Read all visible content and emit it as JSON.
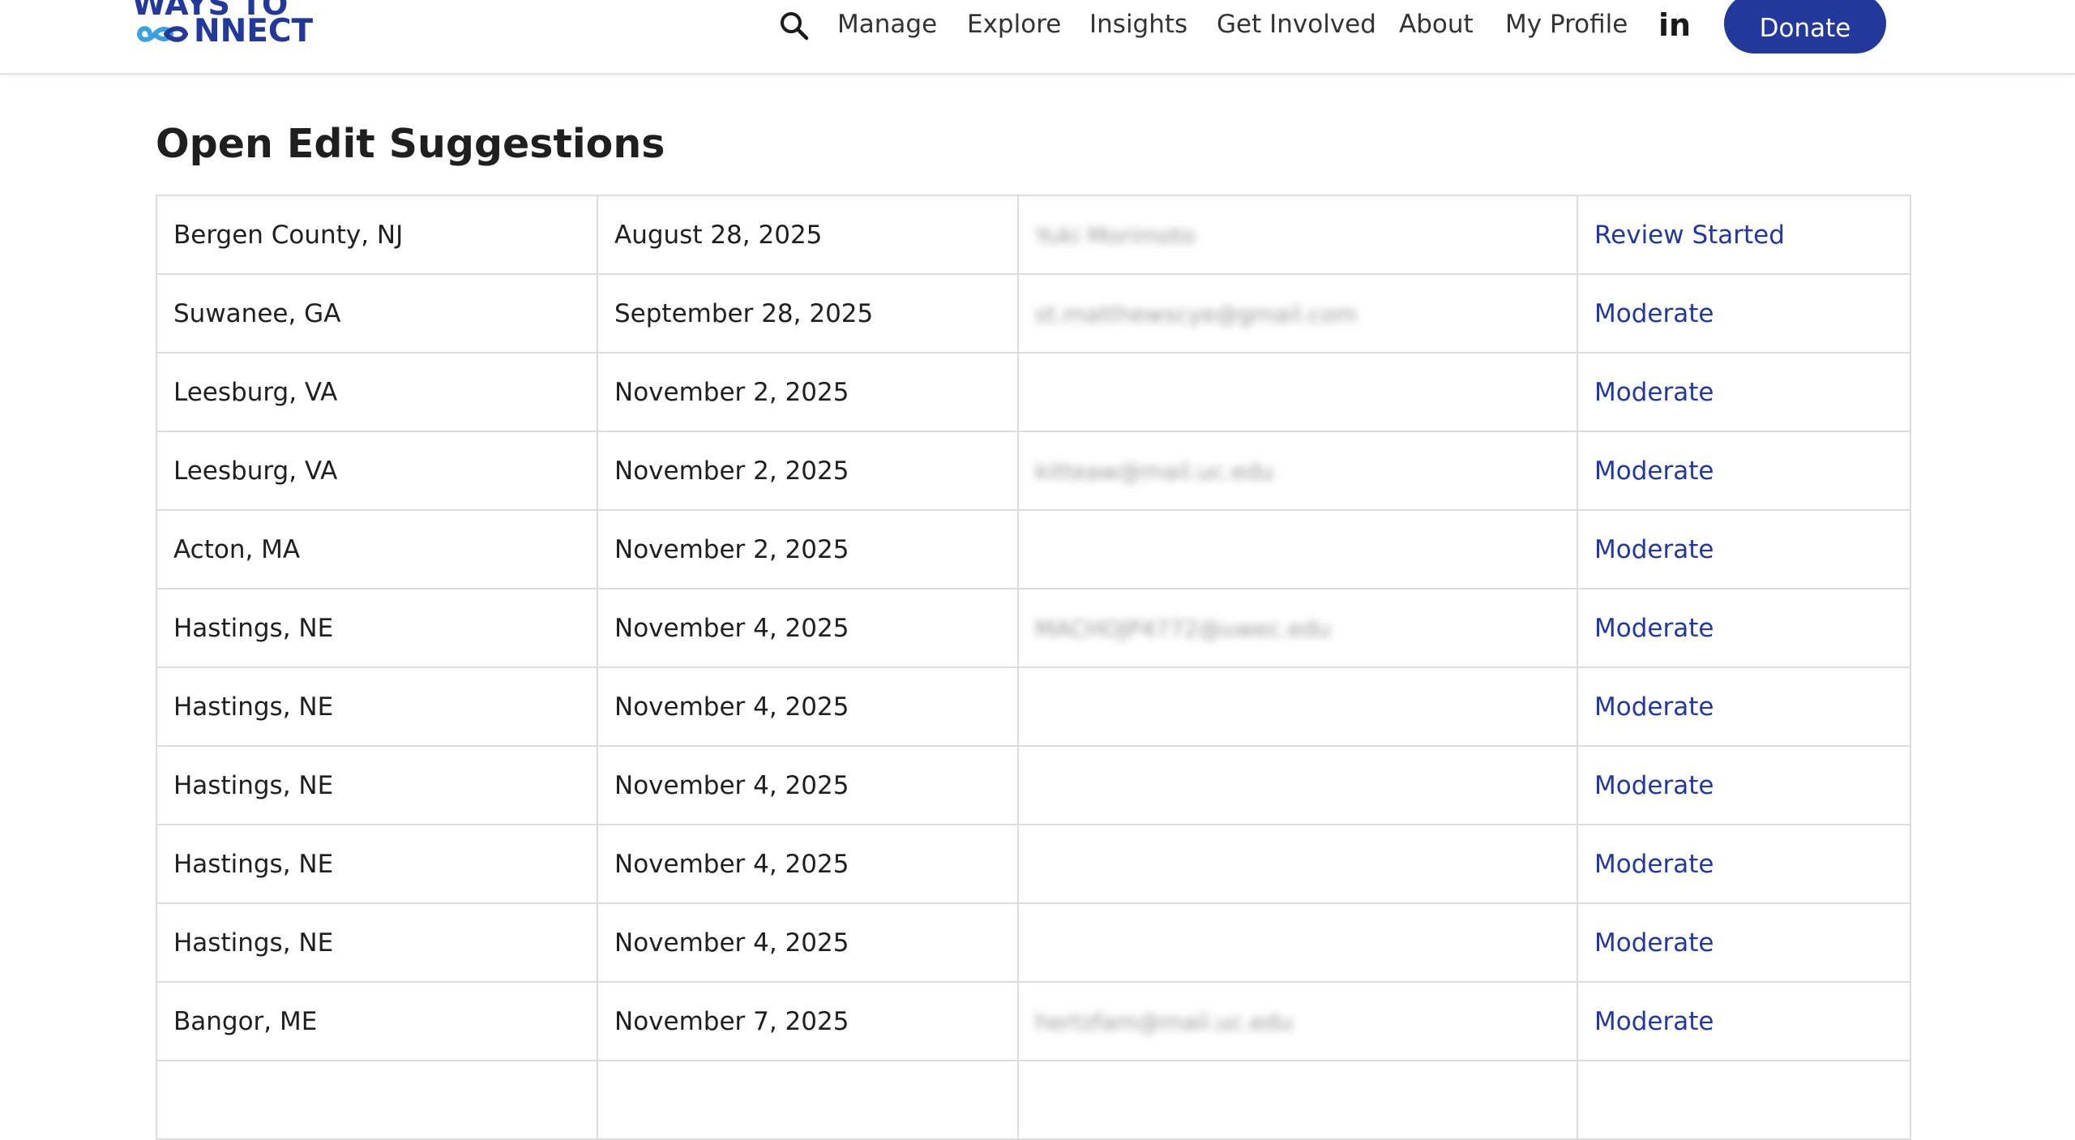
{
  "header": {
    "logo": {
      "line1": "WAYS TO",
      "line2_suffix": "NNECT",
      "brand_color": "#22399b"
    },
    "search_icon": "search-icon",
    "nav": [
      {
        "label": "Manage"
      },
      {
        "label": "Explore"
      },
      {
        "label": "Insights"
      },
      {
        "label": "Get Involved"
      },
      {
        "label": "About"
      },
      {
        "label": "My Profile"
      }
    ],
    "linkedin_label": "in",
    "donate_label": "Donate"
  },
  "main": {
    "title": "Open Edit Suggestions",
    "rows": [
      {
        "location": "Bergen County, NJ",
        "date": "August 28, 2025",
        "submitter": "Yuki Morimoto",
        "action": "Review Started"
      },
      {
        "location": "Suwanee, GA",
        "date": "September 28, 2025",
        "submitter": "st.matthewscye@gmail.com",
        "action": "Moderate"
      },
      {
        "location": "Leesburg, VA",
        "date": "November 2, 2025",
        "submitter": "",
        "action": "Moderate"
      },
      {
        "location": "Leesburg, VA",
        "date": "November 2, 2025",
        "submitter": "kitteaw@mail.uc.edu",
        "action": "Moderate"
      },
      {
        "location": "Acton, MA",
        "date": "November 2, 2025",
        "submitter": "",
        "action": "Moderate"
      },
      {
        "location": "Hastings, NE",
        "date": "November 4, 2025",
        "submitter": "MACHOJP4772@uwec.edu",
        "action": "Moderate"
      },
      {
        "location": "Hastings, NE",
        "date": "November 4, 2025",
        "submitter": "",
        "action": "Moderate"
      },
      {
        "location": "Hastings, NE",
        "date": "November 4, 2025",
        "submitter": "",
        "action": "Moderate"
      },
      {
        "location": "Hastings, NE",
        "date": "November 4, 2025",
        "submitter": "",
        "action": "Moderate"
      },
      {
        "location": "Hastings, NE",
        "date": "November 4, 2025",
        "submitter": "",
        "action": "Moderate"
      },
      {
        "location": "Bangor, ME",
        "date": "November 7, 2025",
        "submitter": "hertzfam@mail.uc.edu",
        "action": "Moderate"
      },
      {
        "location": "",
        "date": "",
        "submitter": "",
        "action": ""
      }
    ]
  }
}
